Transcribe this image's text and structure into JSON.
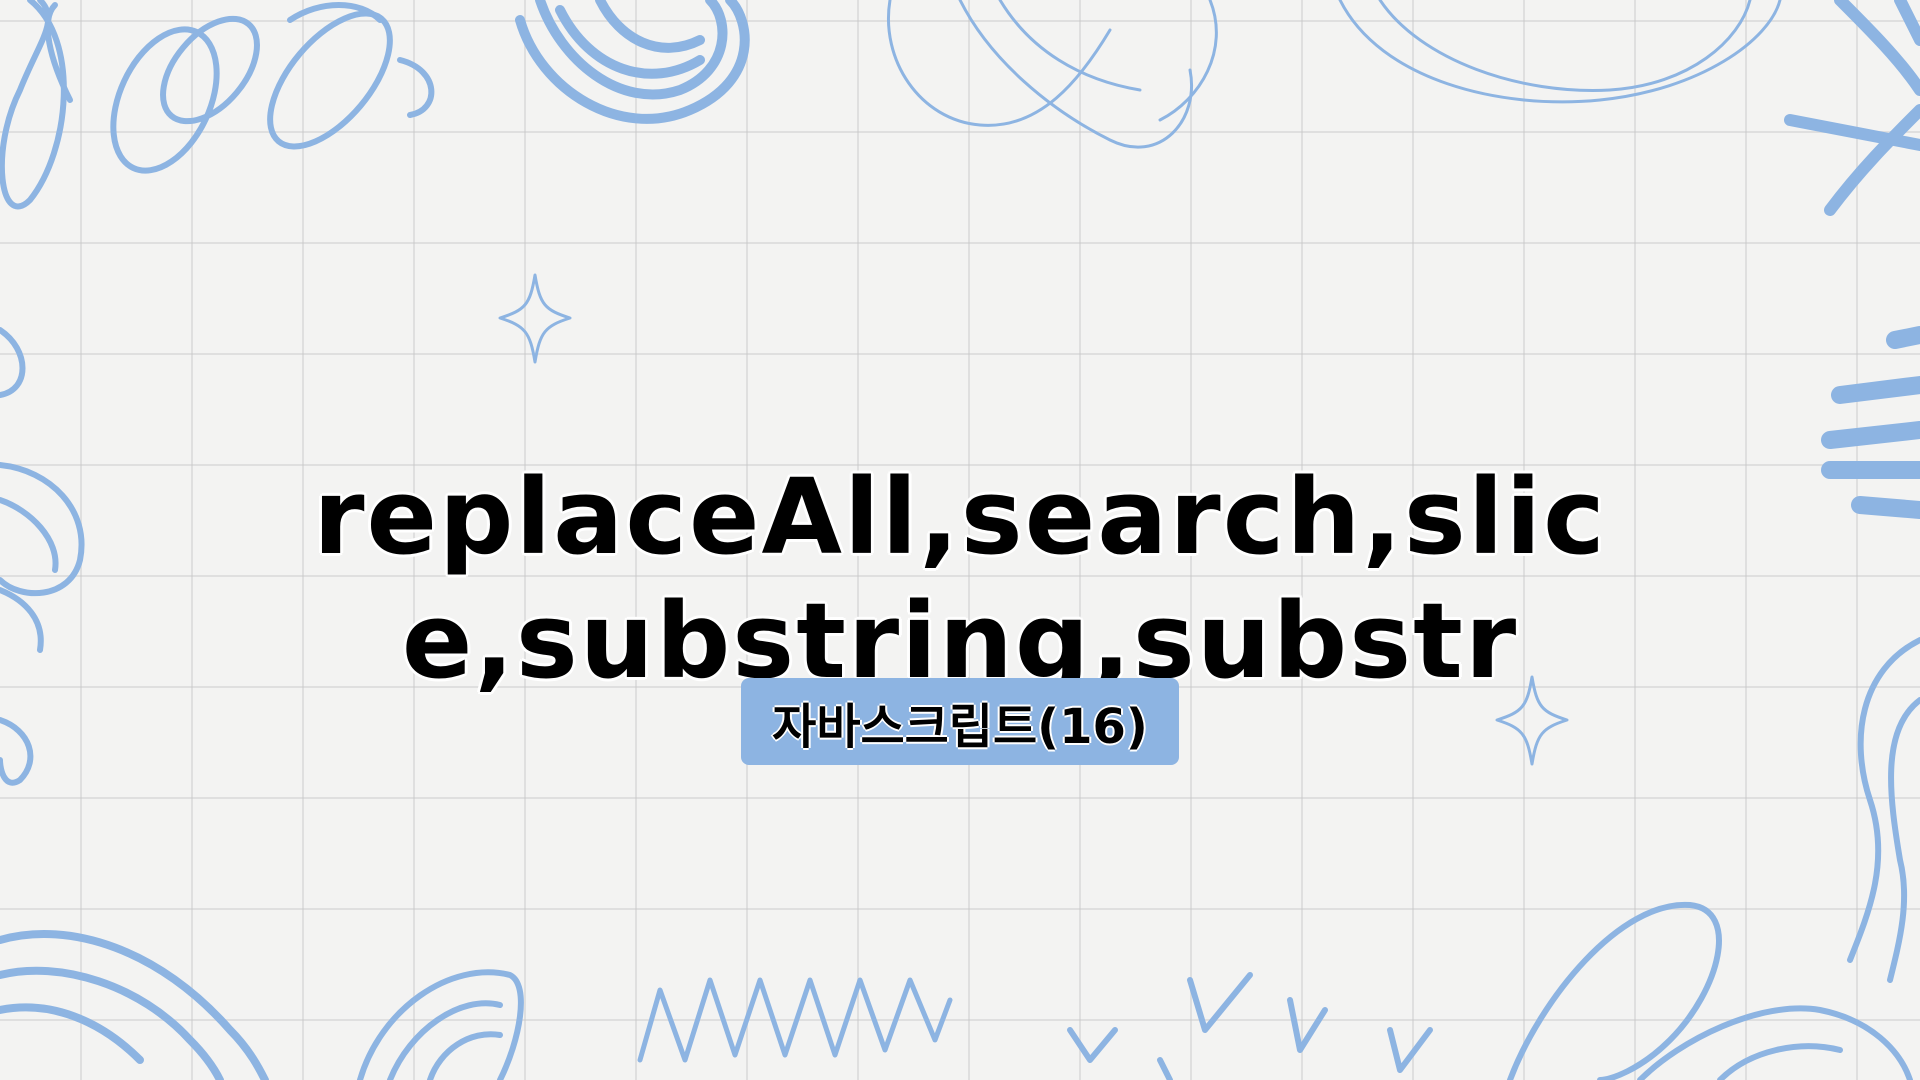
{
  "slide": {
    "title_line1": "replaceAll,search,slic",
    "title_line2": "e,substring,substr",
    "tag": "자바스크립트(16)"
  },
  "colors": {
    "accent": "#8db4e2",
    "background": "#f3f3f2",
    "text": "#000000"
  },
  "decorations": [
    "scribble-loops",
    "scribble-ball",
    "sparkle-icon",
    "sparkle-icon",
    "zigzag",
    "check-marks",
    "brush-strokes"
  ]
}
